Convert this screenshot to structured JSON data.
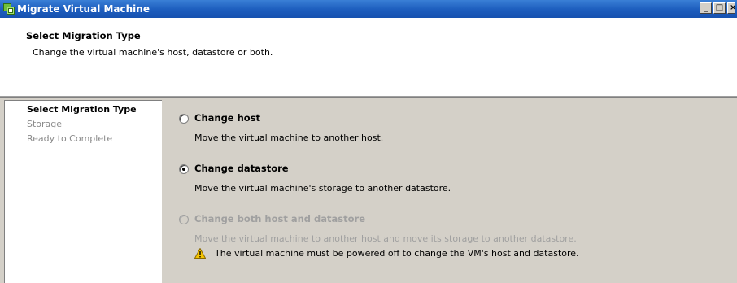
{
  "window": {
    "title": "Migrate Virtual Machine",
    "minimize_glyph": "_",
    "maximize_glyph": "□",
    "close_glyph": "×"
  },
  "header": {
    "title": "Select Migration Type",
    "subtitle": "Change the virtual machine's host, datastore or both."
  },
  "nav": {
    "items": [
      {
        "label": "Select Migration Type",
        "state": "current"
      },
      {
        "label": "Storage",
        "state": "pending"
      },
      {
        "label": "Ready to Complete",
        "state": "pending"
      }
    ]
  },
  "options": [
    {
      "label": "Change host",
      "description": "Move the virtual machine to another host.",
      "selected": false,
      "enabled": true
    },
    {
      "label": "Change datastore",
      "description": "Move the virtual machine's storage to another datastore.",
      "selected": true,
      "enabled": true
    },
    {
      "label": "Change both host and datastore",
      "description": "Move the virtual machine to another host and move its storage to another datastore.",
      "selected": false,
      "enabled": false
    }
  ],
  "warning": {
    "icon": "warning-icon",
    "text": "The virtual machine must be powered off to change the VM's host and datastore."
  },
  "colors": {
    "titlebar": "#1e5fbf",
    "panel": "#d4d0c8",
    "disabled_text": "#a0a0a0",
    "warning": "#f5c400"
  }
}
